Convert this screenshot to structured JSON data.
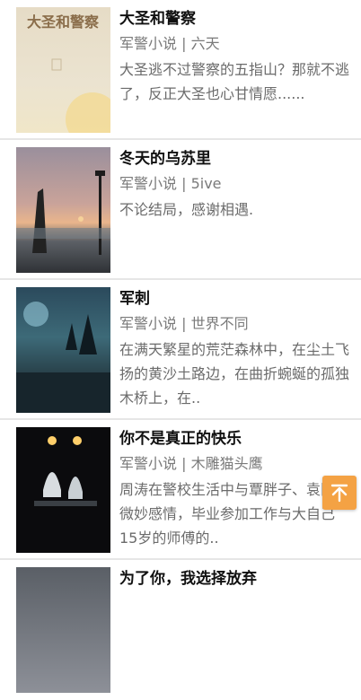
{
  "books": [
    {
      "title": "大圣和警察",
      "category": "军警小说",
      "author": "六天",
      "description": "大圣逃不过警察的五指山？那就不逃了，反正大圣也心甘情愿......",
      "cover_text": "大圣和警察"
    },
    {
      "title": "冬天的乌苏里",
      "category": "军警小说",
      "author": "5ive",
      "description": "不论结局，感谢相遇."
    },
    {
      "title": "军刺",
      "category": "军警小说",
      "author": "世界不同",
      "description": "在满天繁星的荒茫森林中，在尘土飞扬的黄沙土路边，在曲折蜿蜒的孤独木桥上，在.."
    },
    {
      "title": "你不是真正的快乐",
      "category": "军警小说",
      "author": "木雕猫头鹰",
      "description": "周涛在警校生活中与覃胖子、袁队的微妙感情，毕业参加工作与大自己15岁的师傅的.."
    },
    {
      "title": "为了你，我选择放弃",
      "category": "",
      "author": "",
      "description": ""
    }
  ],
  "meta_separator": " | ",
  "scroll_top_icon": "arrow-up-to-top-icon",
  "colors": {
    "fab": "#f4a244",
    "title": "#111111",
    "meta": "#7a7a7a"
  }
}
